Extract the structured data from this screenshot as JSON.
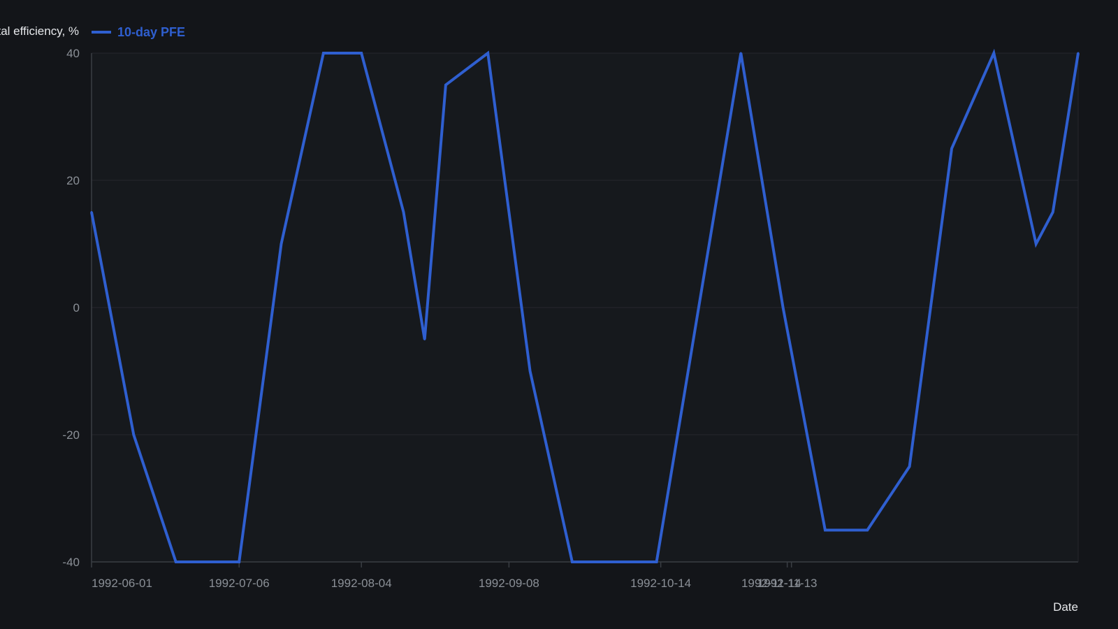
{
  "chart_data": {
    "type": "line",
    "ylabel": "Polarized fractal efficiency, %",
    "xlabel": "Date",
    "ylim": [
      -40,
      40
    ],
    "yticks": [
      40,
      20,
      0,
      -20,
      -40
    ],
    "x_tick_labels": [
      "1992-06-01",
      "1992-07-06",
      "1992-08-04",
      "1992-09-08",
      "1992-10-14",
      "1992-11-13",
      "1992-11-14"
    ],
    "grid": true,
    "legend_position": "top-left",
    "colors": {
      "background": "#131519",
      "plot_background": "#16191d",
      "grid": "#25282d",
      "axis": "#3a3e44",
      "series": "#2f5fd0"
    },
    "series": [
      {
        "name": "10-day PFE",
        "points": [
          [
            "1992-06-01",
            15
          ],
          [
            "1992-06-11",
            -20
          ],
          [
            "1992-06-21",
            -40
          ],
          [
            "1992-07-01",
            -40
          ],
          [
            "1992-07-06",
            -40
          ],
          [
            "1992-07-16",
            10
          ],
          [
            "1992-07-26",
            40
          ],
          [
            "1992-08-04",
            40
          ],
          [
            "1992-08-14",
            15
          ],
          [
            "1992-08-19",
            -5
          ],
          [
            "1992-08-24",
            35
          ],
          [
            "1992-09-03",
            40
          ],
          [
            "1992-09-13",
            -10
          ],
          [
            "1992-09-23",
            -40
          ],
          [
            "1992-10-03",
            -40
          ],
          [
            "1992-10-13",
            -40
          ],
          [
            "1992-10-23",
            0
          ],
          [
            "1992-11-02",
            40
          ],
          [
            "1992-11-12",
            0
          ],
          [
            "1992-11-22",
            -35
          ],
          [
            "1992-12-02",
            -35
          ],
          [
            "1992-12-12",
            -25
          ],
          [
            "1992-12-22",
            25
          ],
          [
            "1993-01-01",
            40
          ],
          [
            "1993-01-11",
            10
          ],
          [
            "1993-01-15",
            15
          ],
          [
            "1993-01-21",
            40
          ]
        ]
      }
    ]
  }
}
